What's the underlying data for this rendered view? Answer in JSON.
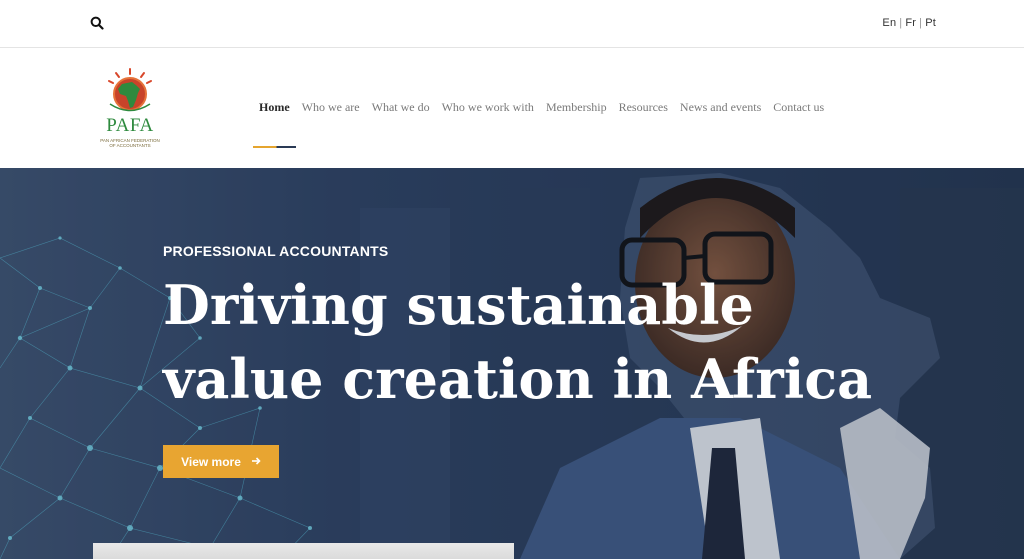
{
  "topbar": {
    "search_icon": "search-icon",
    "languages": [
      "En",
      "Fr",
      "Pt"
    ]
  },
  "logo": {
    "name": "PAFA",
    "subtitle_lines": [
      "PAN AFRICAN FEDERATION",
      "OF ACCOUNTANTS"
    ]
  },
  "nav": {
    "items": [
      {
        "label": "Home",
        "active": true
      },
      {
        "label": "Who we are",
        "active": false
      },
      {
        "label": "What we do",
        "active": false
      },
      {
        "label": "Who we work with",
        "active": false
      },
      {
        "label": "Membership",
        "active": false
      },
      {
        "label": "Resources",
        "active": false
      },
      {
        "label": "News and events",
        "active": false
      },
      {
        "label": "Contact us",
        "active": false
      }
    ]
  },
  "hero": {
    "eyebrow": "PROFESSIONAL ACCOUNTANTS",
    "headline_line1": "Driving sustainable",
    "headline_line2": "value creation in Africa",
    "cta_label": "View more",
    "cta_icon": "arrow-right-icon"
  },
  "colors": {
    "accent": "#e8a531",
    "hero_overlay": "#2a3d58",
    "logo_green": "#2e8a3e",
    "logo_red": "#c8432a",
    "network_cyan": "#5fd4ea"
  }
}
